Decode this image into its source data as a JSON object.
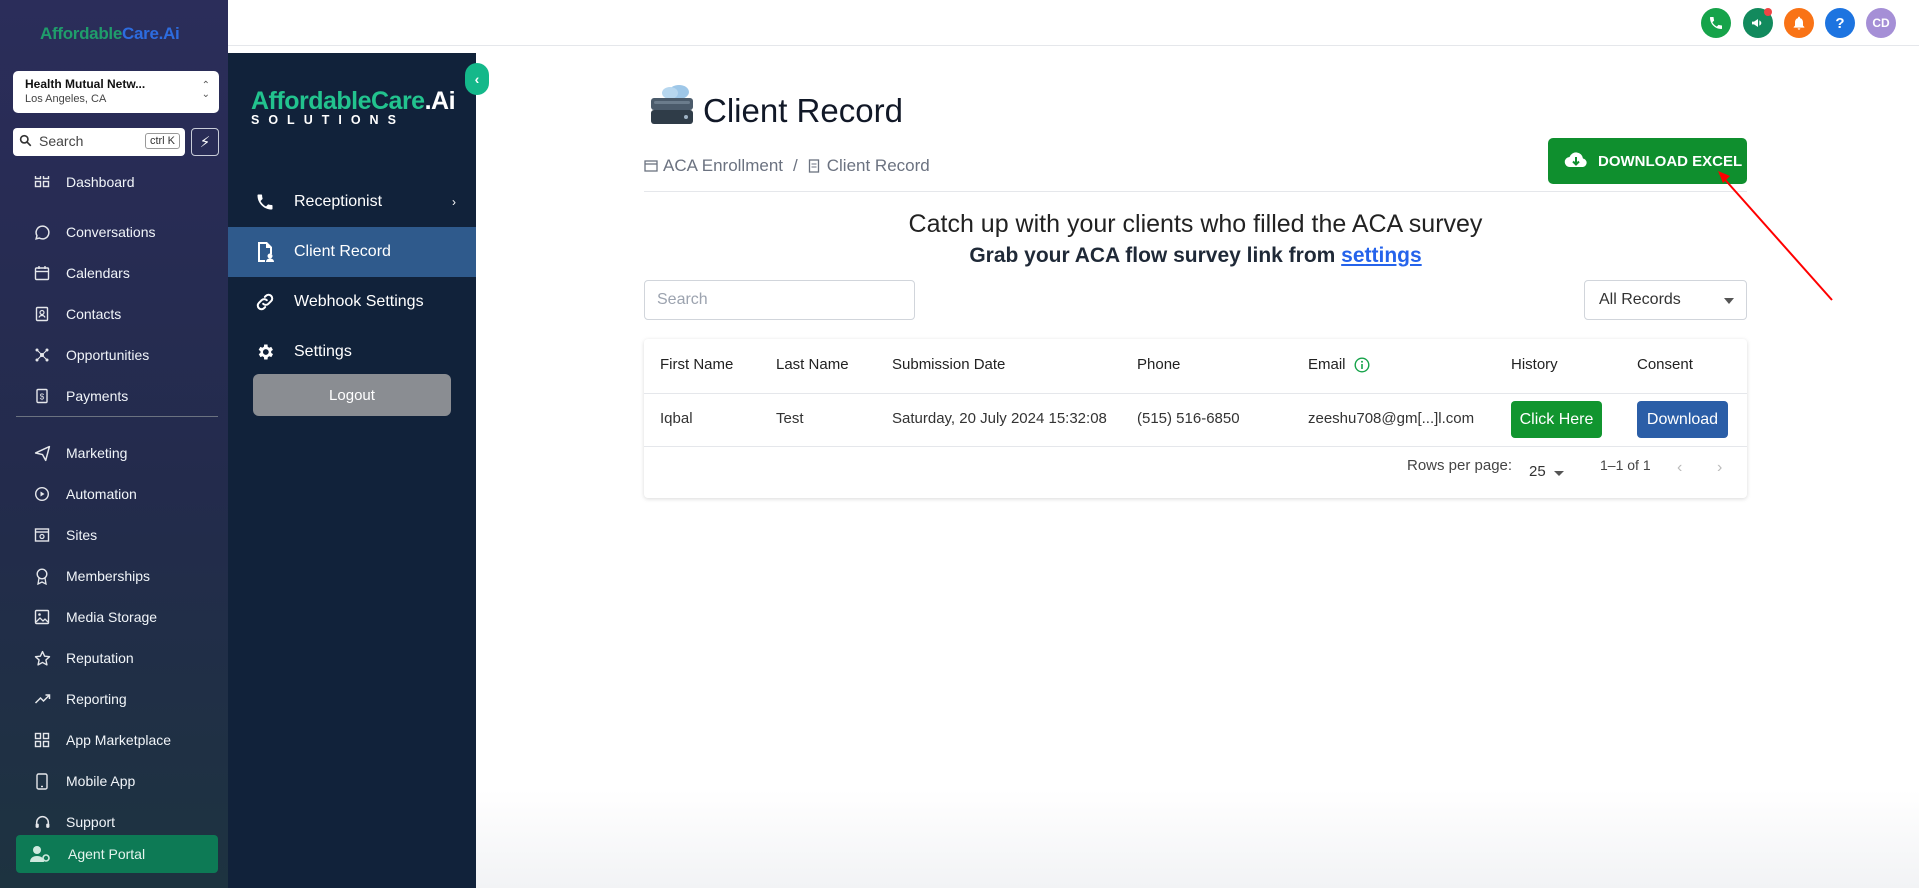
{
  "crm": {
    "logo_part1": "Affordable",
    "logo_part2": "Care.Ai",
    "location_name": "Health Mutual Netw...",
    "location_city": "Los Angeles, CA",
    "search_placeholder": "Search",
    "search_shortcut": "ctrl K",
    "nav": [
      {
        "label": "Dashboard",
        "icon": "dashboard-icon"
      },
      {
        "label": "Conversations",
        "icon": "chat-icon"
      },
      {
        "label": "Calendars",
        "icon": "calendar-icon"
      },
      {
        "label": "Contacts",
        "icon": "contacts-icon"
      },
      {
        "label": "Opportunities",
        "icon": "opportunities-icon"
      },
      {
        "label": "Payments",
        "icon": "payments-icon"
      },
      {
        "label": "Marketing",
        "icon": "send-icon"
      },
      {
        "label": "Automation",
        "icon": "automation-icon"
      },
      {
        "label": "Sites",
        "icon": "sites-icon"
      },
      {
        "label": "Memberships",
        "icon": "award-icon"
      },
      {
        "label": "Media Storage",
        "icon": "image-icon"
      },
      {
        "label": "Reputation",
        "icon": "star-icon"
      },
      {
        "label": "Reporting",
        "icon": "trend-icon"
      },
      {
        "label": "App Marketplace",
        "icon": "grid-icon"
      },
      {
        "label": "Mobile App",
        "icon": "phone-device-icon"
      },
      {
        "label": "Support",
        "icon": "headset-icon"
      }
    ],
    "agent_portal": "Agent Portal"
  },
  "topbar": {
    "avatar_initials": "CD",
    "help": "?"
  },
  "app": {
    "logo_part1": "AffordableCare",
    "logo_part2": ".Ai",
    "logo_sub": "SOLUTIONS",
    "nav": {
      "receptionist": "Receptionist",
      "client_record": "Client Record",
      "webhook_settings": "Webhook Settings",
      "settings": "Settings"
    },
    "logout": "Logout"
  },
  "main": {
    "title": "Client Record",
    "breadcrumb": [
      "ACA Enrollment",
      "Client Record"
    ],
    "breadcrumb_sep": "/",
    "download_excel": "DOWNLOAD EXCEL",
    "intro_line1": "Catch up with your clients who filled the ACA survey",
    "intro_line2": "Grab your ACA flow survey link from",
    "intro_link": "settings",
    "search_placeholder": "Search",
    "filter_value": "All Records",
    "table": {
      "headers": [
        "First Name",
        "Last Name",
        "Submission Date",
        "Phone",
        "Email",
        "History",
        "Consent"
      ],
      "rows": [
        {
          "first_name": "Iqbal",
          "last_name": "Test",
          "submission_date": "Saturday, 20 July 2024 15:32:08",
          "phone": "(515) 516-6850",
          "email": "zeeshu708@gm[...]l.com",
          "history_button": "Click Here",
          "consent_button": "Download"
        }
      ],
      "rows_per_page_label": "Rows per page:",
      "rows_per_page": "25",
      "page_info": "1–1 of 1"
    }
  },
  "colors": {
    "crm_sidebar": "#2b2d5a",
    "app_sidebar": "#11223a",
    "active_nav": "#2f5a8c",
    "download_excel": "#0f8f2e",
    "history_btn": "#11952f",
    "consent_btn": "#2b5ea7",
    "annotation_arrow": "#ff0000"
  }
}
